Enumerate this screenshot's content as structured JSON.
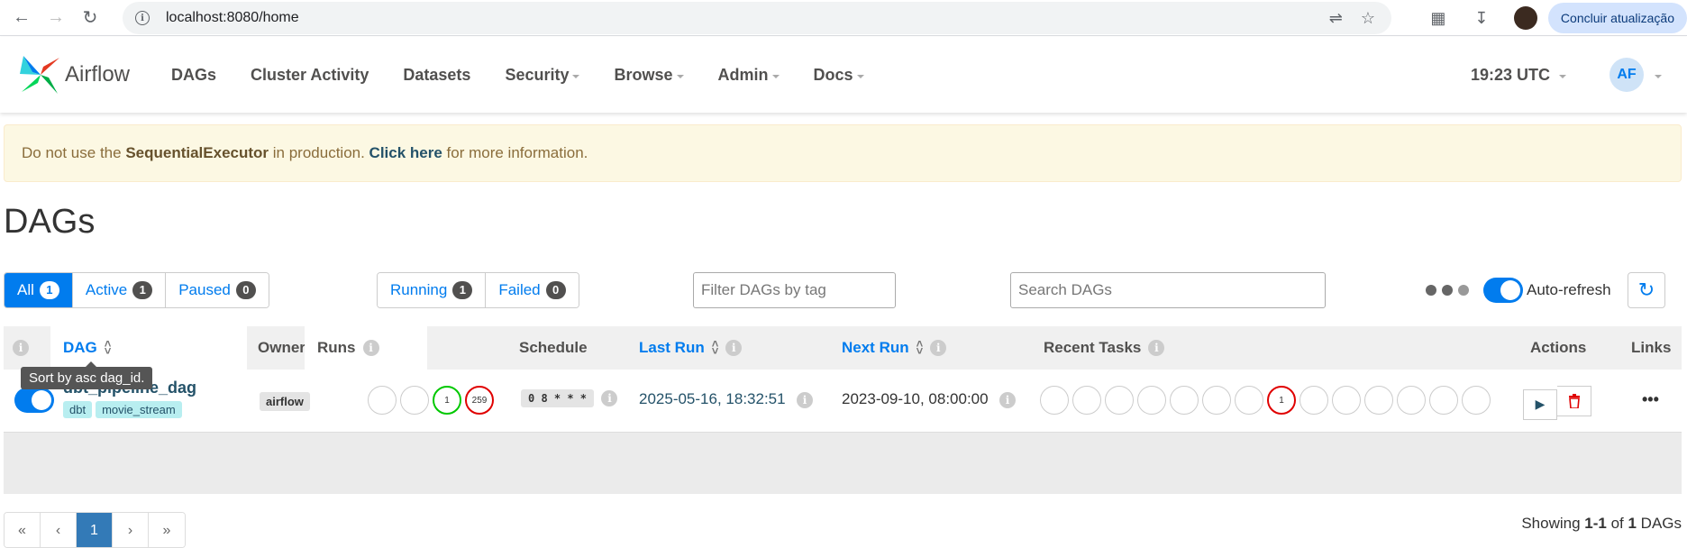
{
  "browser": {
    "url": "localhost:8080/home",
    "update_label": "Concluir atualização"
  },
  "navbar": {
    "brand": "Airflow",
    "items": [
      {
        "label": "DAGs",
        "dropdown": false
      },
      {
        "label": "Cluster Activity",
        "dropdown": false
      },
      {
        "label": "Datasets",
        "dropdown": false
      },
      {
        "label": "Security",
        "dropdown": true
      },
      {
        "label": "Browse",
        "dropdown": true
      },
      {
        "label": "Admin",
        "dropdown": true
      },
      {
        "label": "Docs",
        "dropdown": true
      }
    ],
    "clock": "19:23 UTC",
    "avatar": "AF"
  },
  "alert": {
    "prefix": "Do not use the ",
    "executor": "SequentialExecutor",
    "middle": " in production. ",
    "link": "Click here",
    "suffix": " for more information."
  },
  "page_title": "DAGs",
  "filters": {
    "status": [
      {
        "label": "All",
        "count": "1"
      },
      {
        "label": "Active",
        "count": "1"
      },
      {
        "label": "Paused",
        "count": "0"
      }
    ],
    "runs": [
      {
        "label": "Running",
        "count": "1"
      },
      {
        "label": "Failed",
        "count": "0"
      }
    ],
    "tag_placeholder": "Filter DAGs by tag",
    "search_placeholder": "Search DAGs",
    "autorefresh_label": "Auto-refresh"
  },
  "table": {
    "headers": {
      "dag": "DAG",
      "owner": "Owner",
      "runs": "Runs",
      "schedule": "Schedule",
      "last_run": "Last Run",
      "next_run": "Next Run",
      "recent_tasks": "Recent Tasks",
      "actions": "Actions",
      "links": "Links"
    },
    "rows": [
      {
        "dag_id": "dbt_pipeline_dag",
        "tags": [
          "dbt",
          "movie_stream"
        ],
        "owner": "airflow",
        "runs": [
          "",
          "",
          "1",
          "259"
        ],
        "schedule": "0 8 * * *",
        "last_run": "2025-05-16, 18:32:51",
        "next_run": "2023-09-10, 08:00:00",
        "recent_tasks": [
          "",
          "",
          "",
          "",
          "",
          "",
          "",
          "1",
          "",
          "",
          "",
          "",
          "",
          ""
        ]
      }
    ]
  },
  "tooltip": "Sort by asc dag_id.",
  "pagination": {
    "pages": [
      "«",
      "‹",
      "1",
      "›",
      "»"
    ],
    "showing_prefix": "Showing ",
    "range": "1-1",
    "of": " of ",
    "total": "1",
    "suffix": " DAGs"
  },
  "colors": {
    "accent": "#017cee",
    "success": "#00c800",
    "failed": "#e00000",
    "alert_bg": "#fcf8e3"
  }
}
